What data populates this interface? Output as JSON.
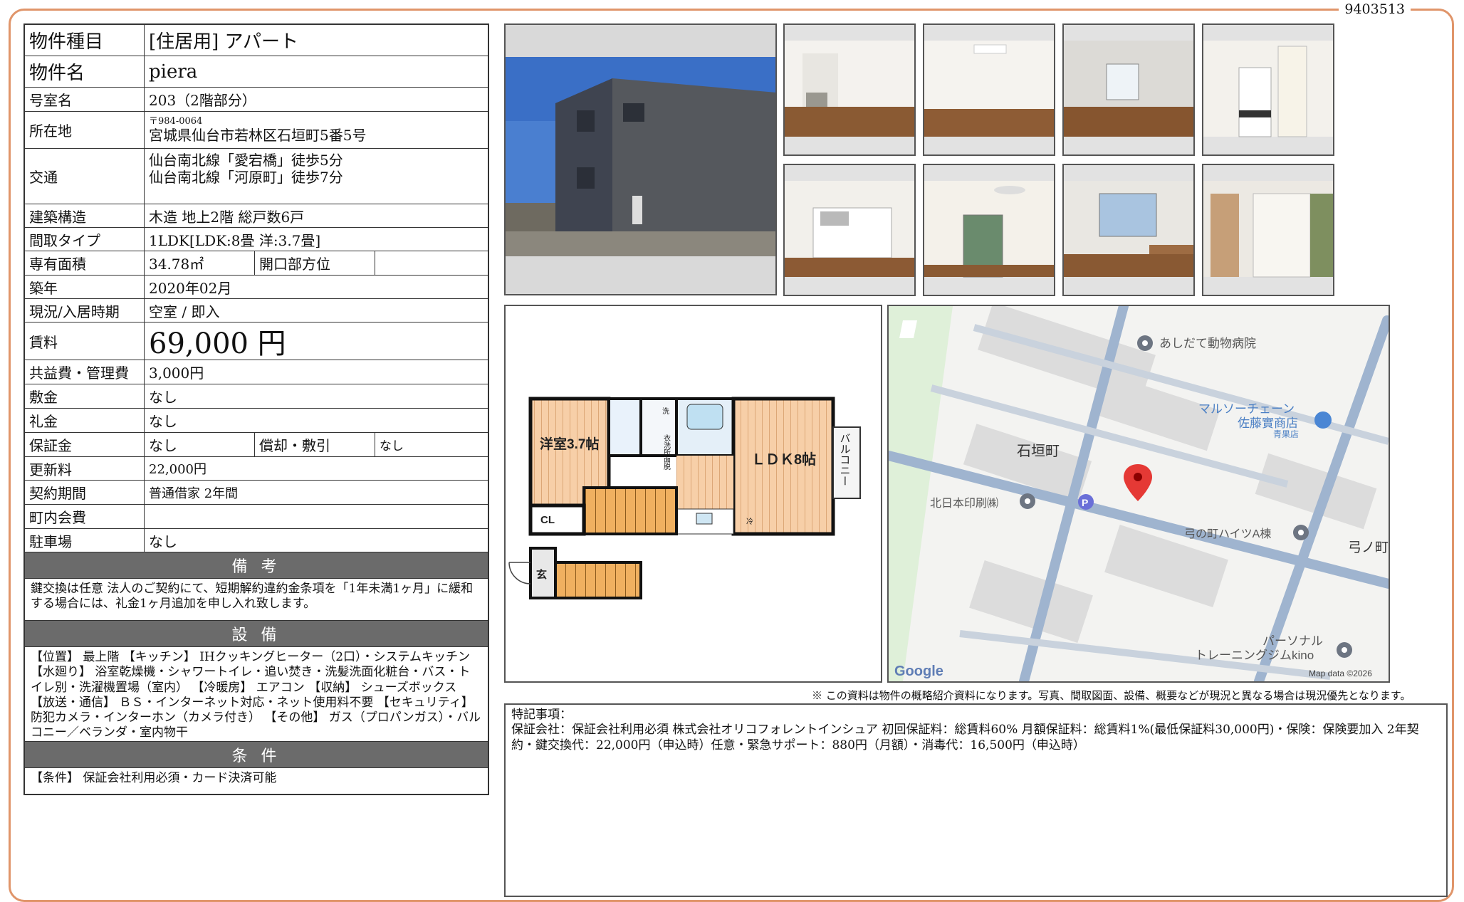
{
  "doc_id": "9403513",
  "spec": {
    "type_label": "物件種目",
    "type_value": "[住居用]  アパート",
    "name_label": "物件名",
    "name_value": "piera",
    "room_label": "号室名",
    "room_value": "203（2階部分）",
    "address_label": "所在地",
    "address_zip": "〒984-0064",
    "address_value": "宮城県仙台市若林区石垣町5番5号",
    "transit_label": "交通",
    "transit_1": "仙台南北線「愛宕橋」徒歩5分",
    "transit_2": "仙台南北線「河原町」徒歩7分",
    "structure_label": "建築構造",
    "structure_value": "木造  地上2階  総戸数6戸",
    "layout_label": "間取タイプ",
    "layout_value": "1LDK[LDK:8畳  洋:3.7畳]",
    "area_label": "専有面積",
    "area_value": "34.78㎡",
    "direction_label": "開口部方位",
    "direction_value": "",
    "built_label": "築年",
    "built_value": "2020年02月",
    "status_label": "現況/入居時期",
    "status_value": "空室  /  即入",
    "rent_label": "賃料",
    "rent_value": "69,000 円",
    "fee_label": "共益費・管理費",
    "fee_value": "3,000円",
    "deposit_label": "敷金",
    "deposit_value": "なし",
    "keymoney_label": "礼金",
    "keymoney_value": "なし",
    "guarantee_label": "保証金",
    "guarantee_value": "なし",
    "amort_label": "償却・敷引",
    "amort_value": "なし",
    "renewal_label": "更新料",
    "renewal_value": "22,000円",
    "contract_label": "契約期間",
    "contract_value": "普通借家  2年間",
    "town_label": "町内会費",
    "town_value": "",
    "parking_label": "駐車場",
    "parking_value": "なし"
  },
  "remarks_band": "備 考",
  "remarks_text": "鍵交換は任意  法人のご契約にて、短期解約違約金条項を「1年未満1ヶ月」に緩和する場合には、礼金1ヶ月追加を申し入れ致します。",
  "equipment_band": "設 備",
  "equipment_text": "【位置】 最上階 【キッチン】 IHクッキングヒーター（2口）・システムキッチン 【水廻り】 浴室乾燥機・シャワートイレ・追い焚き・洗髪洗面化粧台・バス・トイレ別・洗濯機置場（室内） 【冷暖房】 エアコン 【収納】 シューズボックス 【放送・通信】 ＢＳ・インターネット対応・ネット使用料不要 【セキュリティ】 防犯カメラ・インターホン（カメラ付き） 【その他】 ガス（プロパンガス）・バルコニー／ベランダ・室内物干",
  "conditions_band": "条 件",
  "conditions_text": "【条件】 保証会社利用必須・カード決済可能",
  "floorplan": {
    "room_western": "洋室3.7帖",
    "room_ldk": "ＬＤＫ8帖",
    "balcony": "バルコニー",
    "closet": "CL",
    "entrance": "玄",
    "laundry": "衣洗所面脱",
    "fridge": "冷",
    "washer": "洗"
  },
  "map": {
    "poi_vet": "あしだて動物病院",
    "poi_store_1": "マルソーチェーン",
    "poi_store_2": "佐藤實商店",
    "poi_store_3": "青果店",
    "area_ishigaki": "石垣町",
    "poi_print": "北日本印刷㈱",
    "poi_heights": "弓の町ハイツA棟",
    "area_yuminomachi": "弓ノ町",
    "poi_gym_1": "パーソナル",
    "poi_gym_2": "トレーニングジムkino",
    "parking_symbol": "P",
    "logo": "Google",
    "attribution": "Map data ©2026"
  },
  "disclaimer": "※ この資料は物件の概略紹介資料になります。写真、間取図面、設備、概要などが現況と異なる場合は現況優先となります。",
  "special": {
    "title": "特記事項：",
    "text": "保証会社：保証会社利用必須 株式会社オリコフォレントインシュア 初回保証料：総賃料60%  月額保証料：総賃料1%(最低保証料30,000円)・保険：保険要加入 2年契約・鍵交換代：22,000円（申込時）任意・緊急サポート：880円（月額）・消毒代：16,500円（申込時）"
  },
  "photos": [
    "exterior-photo",
    "room-photo-1",
    "room-photo-2",
    "room-photo-3",
    "room-photo-4",
    "room-photo-5",
    "room-photo-6",
    "room-photo-7",
    "room-photo-8"
  ]
}
